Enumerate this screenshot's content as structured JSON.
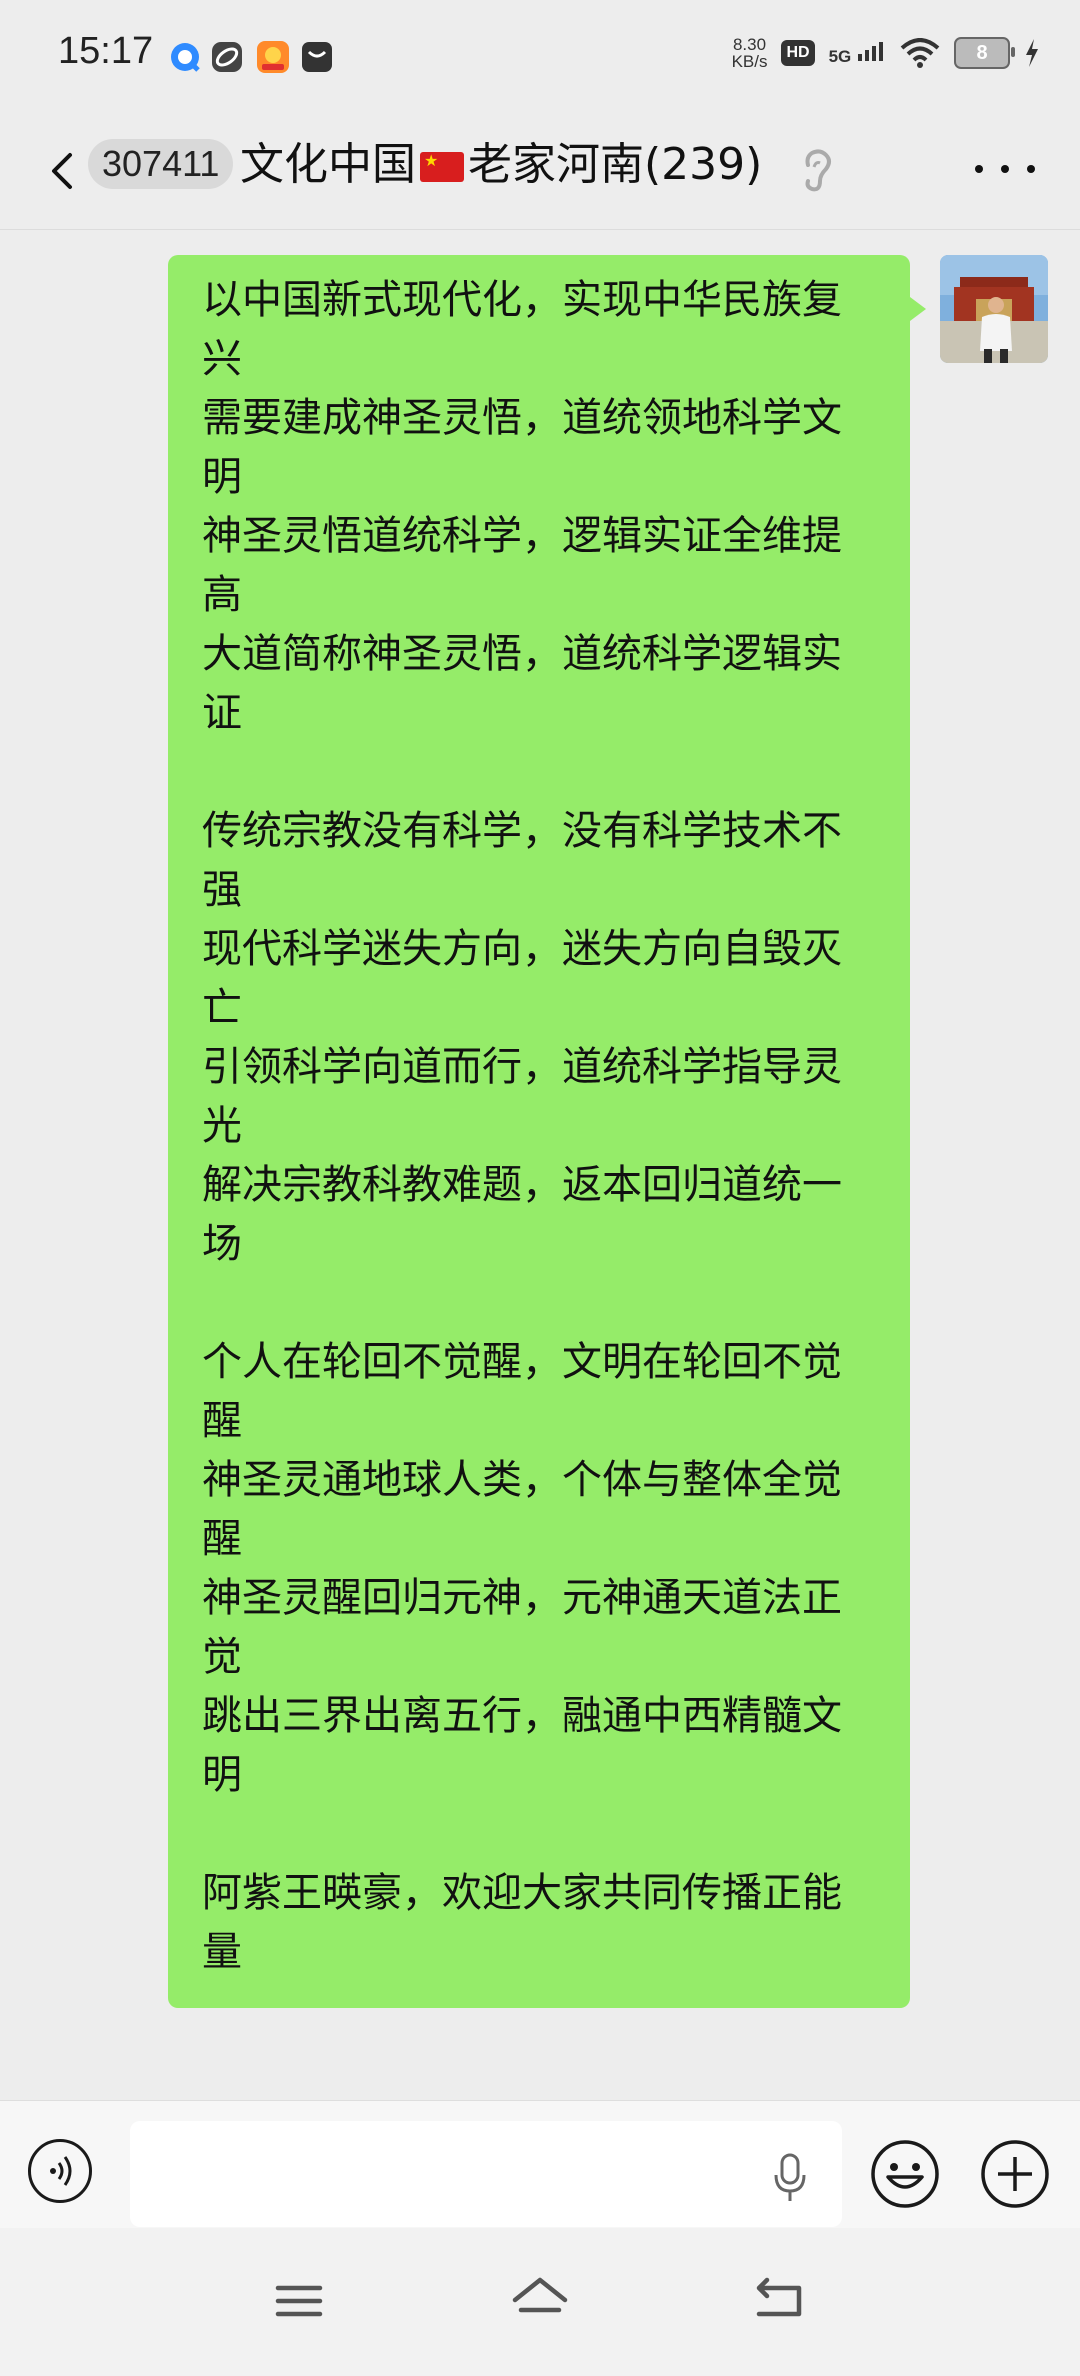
{
  "status_bar": {
    "time": "15:17",
    "net_speed_value": "8.30",
    "net_speed_unit": "KB/s",
    "hd_badge": "HD",
    "network": "5G",
    "battery": "8"
  },
  "header": {
    "unread_count": "307411",
    "chat_title_part1": "文化中国",
    "chat_title_part2": "老家河南(239)"
  },
  "message": {
    "text": "以中国新式现代化，实现中华民族复兴\n需要建成神圣灵悟，道统领地科学文明\n神圣灵悟道统科学，逻辑实证全维提高\n大道简称神圣灵悟，道统科学逻辑实证\n\n传统宗教没有科学，没有科学技术不强\n现代科学迷失方向，迷失方向自毁灭亡\n引领科学向道而行，道统科学指导灵光\n解决宗教科教难题，返本回归道统一场\n\n个人在轮回不觉醒，文明在轮回不觉醒\n神圣灵通地球人类，个体与整体全觉醒\n神圣灵醒回归元神，元神通天道法正觉\n跳出三界出离五行，融通中西精髓文明\n\n阿紫王暎豪，欢迎大家共同传播正能量"
  },
  "input": {
    "placeholder": ""
  },
  "colors": {
    "bubble": "#95ec69",
    "background": "#ededed"
  }
}
